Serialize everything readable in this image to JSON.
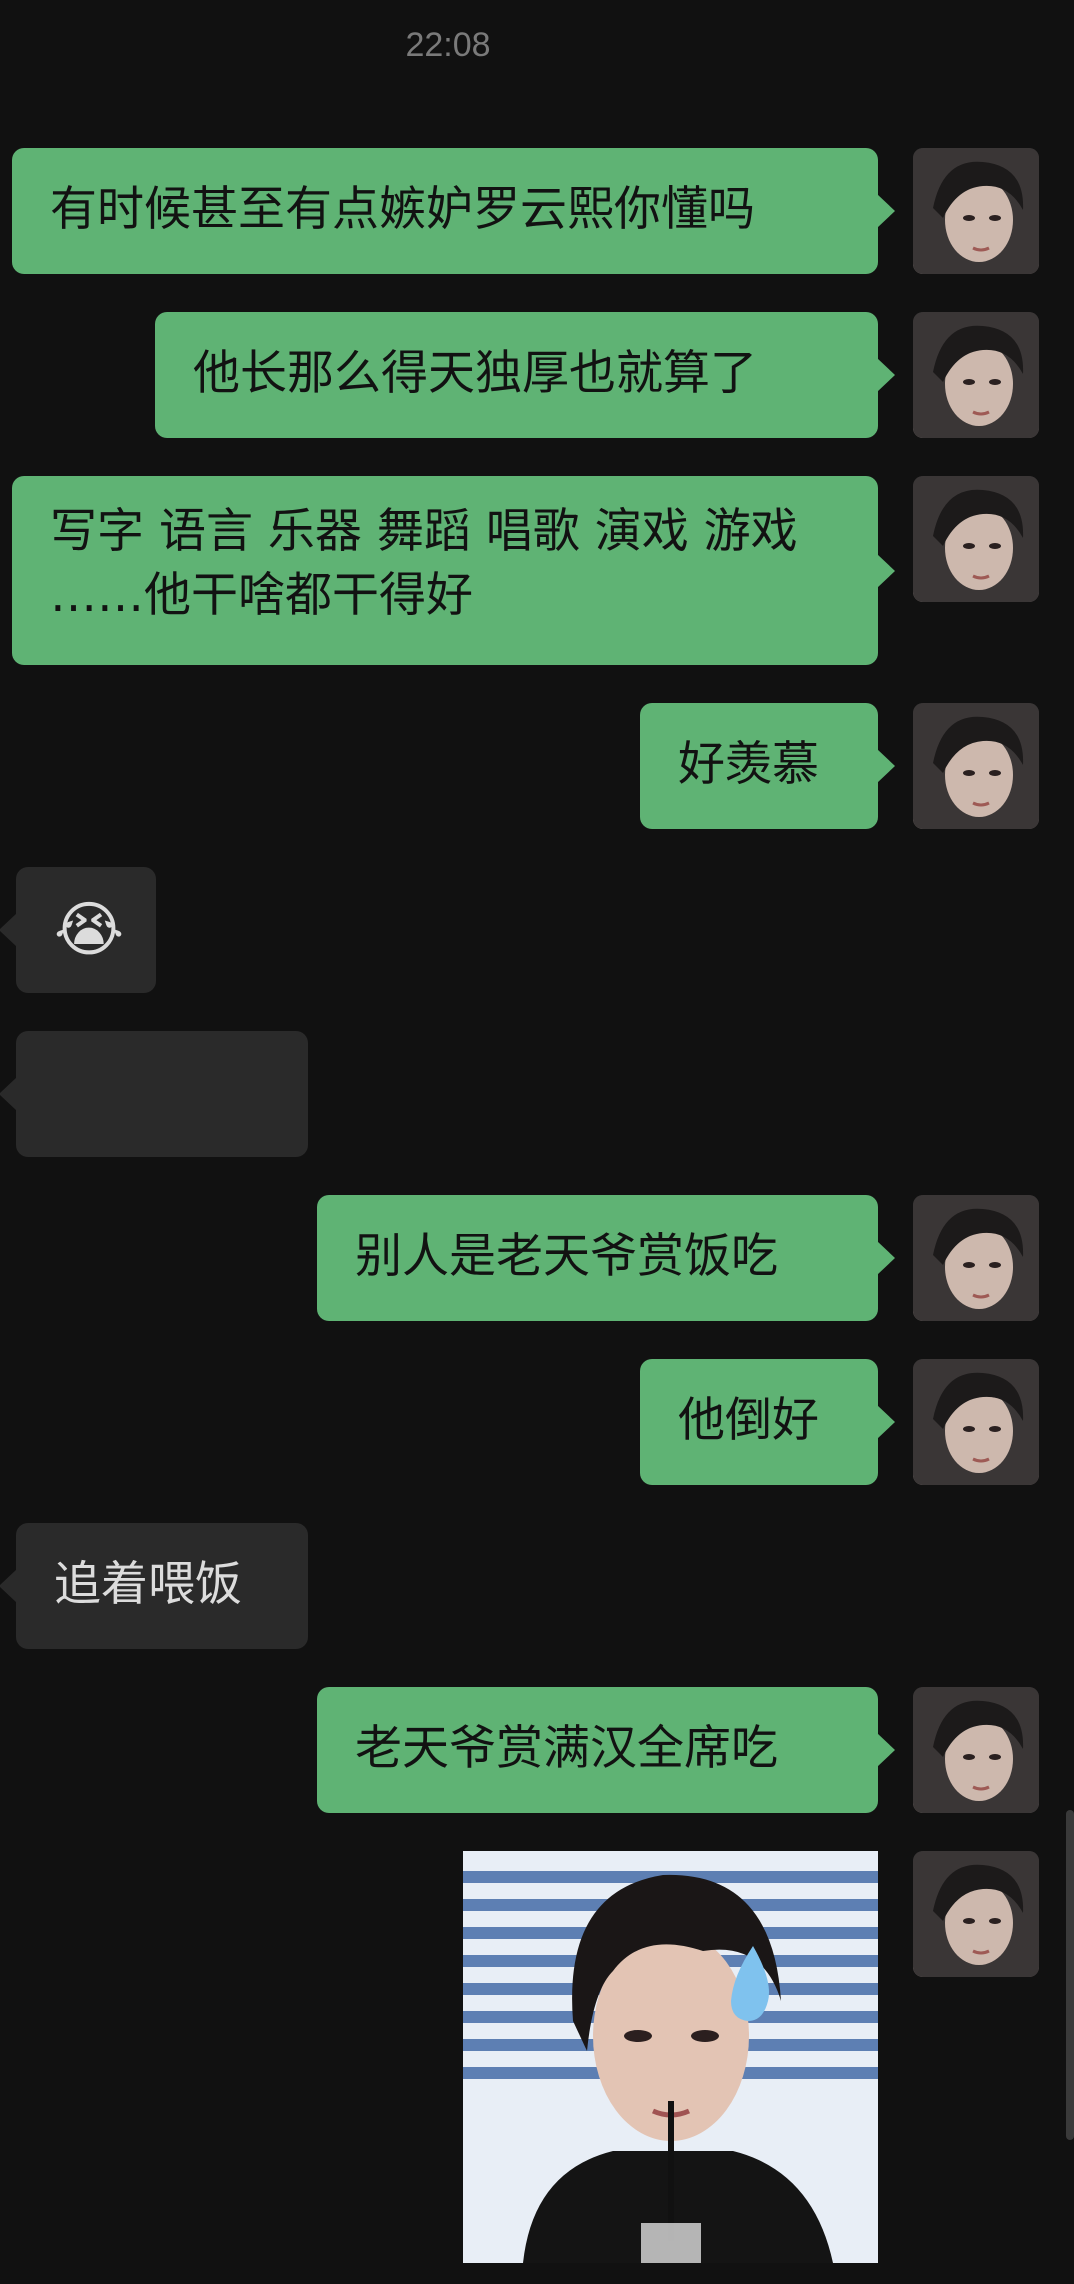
{
  "header": {
    "time": "22:08"
  },
  "messages": [
    {
      "side": "out",
      "text": "有时候甚至有点嫉妒罗云熙你懂吗"
    },
    {
      "side": "out",
      "text": "他长那么得天独厚也就算了"
    },
    {
      "side": "out",
      "text": "写字 语言 乐器 舞蹈 唱歌 演戏 游戏 ……他干啥都干得好"
    },
    {
      "side": "out",
      "text": "好羡慕"
    },
    {
      "side": "in",
      "text": "😭"
    },
    {
      "side": "in",
      "text": ""
    },
    {
      "side": "out",
      "text": "别人是老天爷赏饭吃"
    },
    {
      "side": "out",
      "text": "他倒好"
    },
    {
      "side": "in",
      "text": "追着喂饭"
    },
    {
      "side": "out",
      "text": "老天爷赏满汉全席吃"
    },
    {
      "side": "out",
      "type": "image",
      "image_icon": "portrait-photo-with-sweat-drop"
    }
  ],
  "colors": {
    "background": "#111111",
    "outgoing": "#5fb374",
    "incoming": "#2a2a2a"
  }
}
